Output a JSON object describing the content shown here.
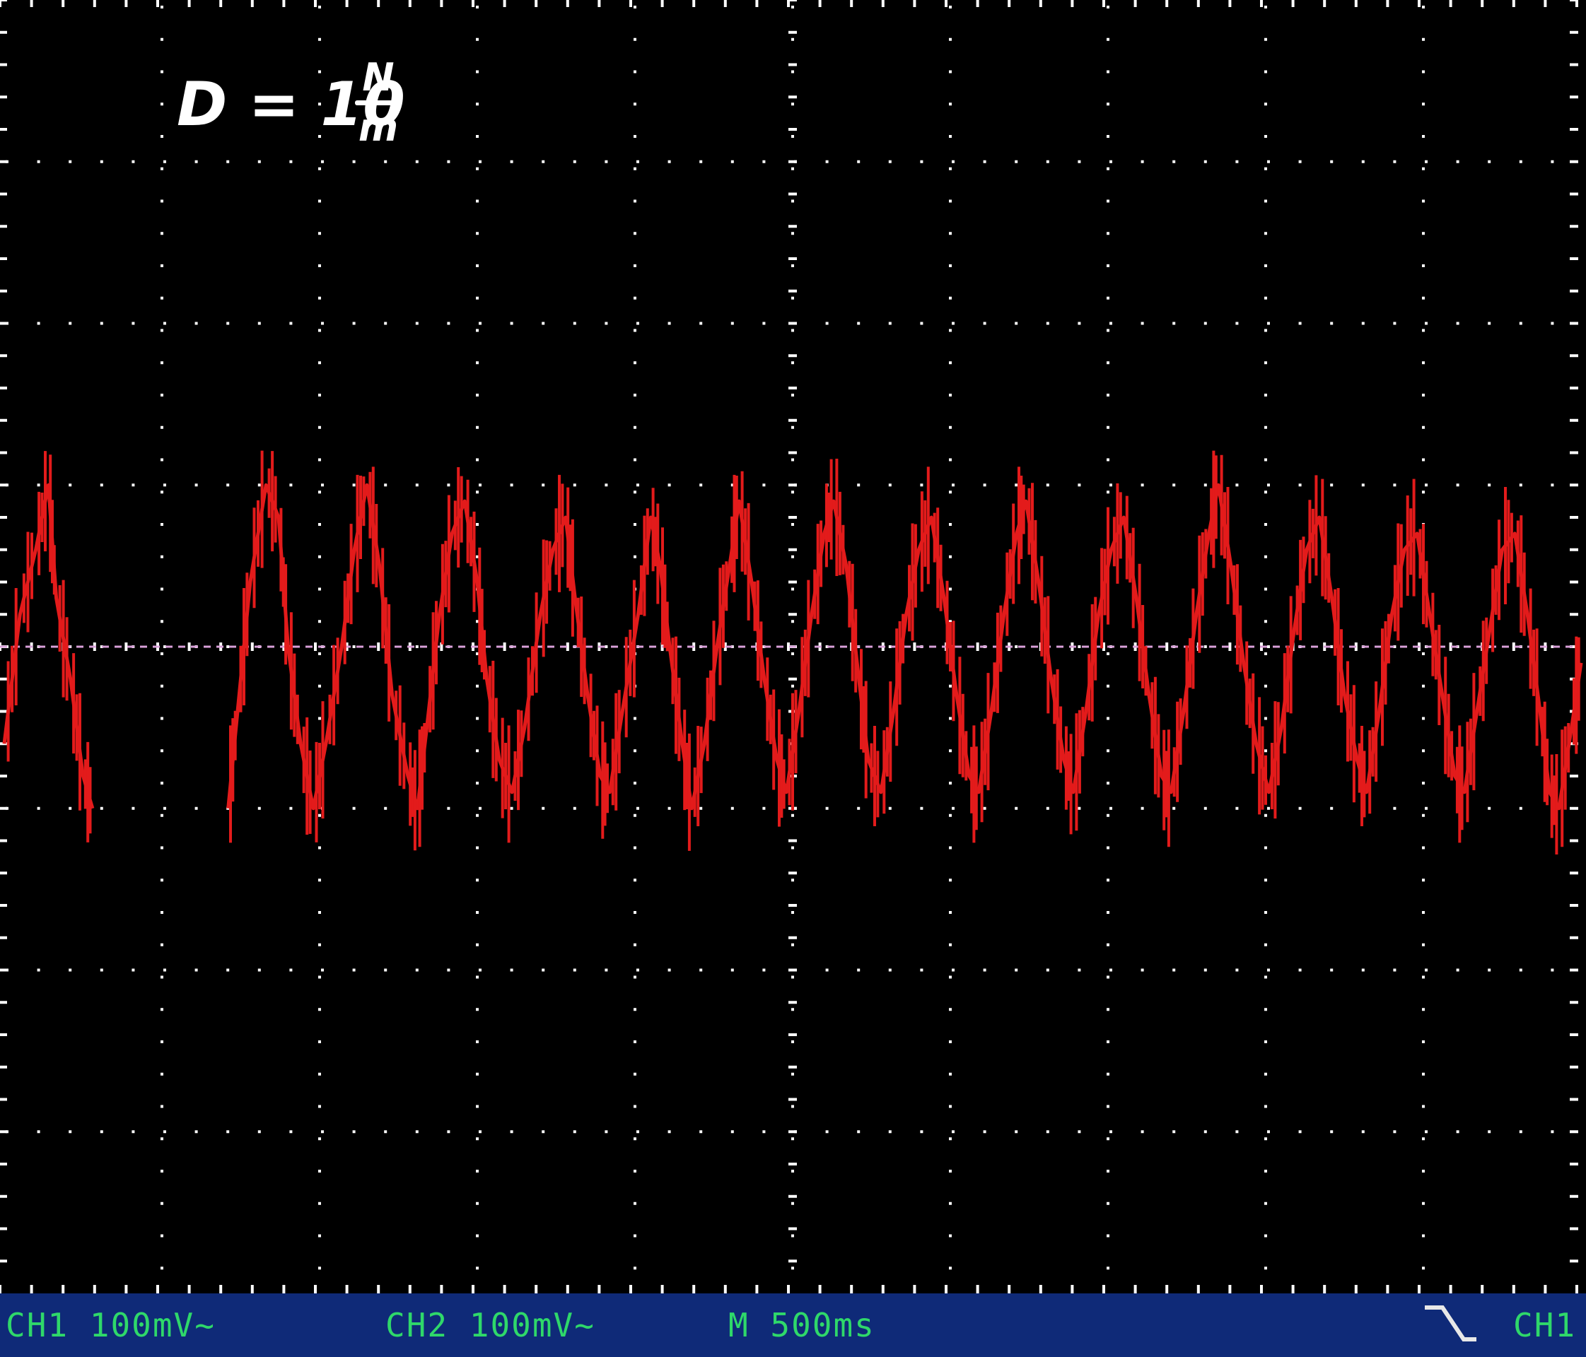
{
  "annotation": {
    "lhs": "D = 10",
    "numerator": "N",
    "denominator": "m"
  },
  "status": {
    "ch1": "CH1 100mV~",
    "ch2": "CH2 100mV~",
    "timebase": "M 500ms",
    "trigger_source": "CH1",
    "trigger_slope_icon": "falling-edge-icon"
  },
  "colors": {
    "screen": "#000000",
    "grid": "#ffffff",
    "trace": "#e31b1b",
    "reference_line": "#d9a0d9",
    "status_bar": "#0f2a78",
    "status_text": "#2fd86a"
  },
  "chart_data": {
    "type": "line",
    "title": "",
    "xlabel": "",
    "ylabel": "",
    "x_divisions": 10,
    "y_divisions": 8,
    "x_unit_per_div": "500ms",
    "y_unit_per_div": "100mV",
    "xlim": [
      0,
      10
    ],
    "ylim": [
      -4,
      4
    ],
    "grid": true,
    "series": [
      {
        "values_note_x_in_div_y_in_div": "",
        "points": [
          [
            0.0,
            -0.6
          ],
          [
            0.1,
            0.2
          ],
          [
            0.2,
            0.6
          ],
          [
            0.28,
            1.0
          ],
          [
            0.33,
            0.3
          ],
          [
            0.42,
            -0.2
          ],
          [
            0.5,
            -0.8
          ],
          [
            0.56,
            -1.0
          ],
          [
            1.42,
            -1.0
          ],
          [
            1.48,
            -0.4
          ],
          [
            1.56,
            0.4
          ],
          [
            1.66,
            1.0
          ],
          [
            1.74,
            0.8
          ],
          [
            1.8,
            0.0
          ],
          [
            1.88,
            -0.6
          ],
          [
            1.96,
            -1.0
          ],
          [
            2.04,
            -0.6
          ],
          [
            2.14,
            0.0
          ],
          [
            2.22,
            0.6
          ],
          [
            2.3,
            1.0
          ],
          [
            2.38,
            0.5
          ],
          [
            2.46,
            -0.3
          ],
          [
            2.56,
            -0.8
          ],
          [
            2.62,
            -1.0
          ],
          [
            2.68,
            -0.5
          ],
          [
            2.76,
            0.2
          ],
          [
            2.84,
            0.7
          ],
          [
            2.92,
            0.9
          ],
          [
            3.0,
            0.4
          ],
          [
            3.06,
            -0.2
          ],
          [
            3.14,
            -0.7
          ],
          [
            3.22,
            -0.9
          ],
          [
            3.3,
            -0.5
          ],
          [
            3.4,
            0.2
          ],
          [
            3.48,
            0.6
          ],
          [
            3.56,
            0.8
          ],
          [
            3.62,
            0.3
          ],
          [
            3.7,
            -0.3
          ],
          [
            3.78,
            -0.8
          ],
          [
            3.84,
            -0.9
          ],
          [
            3.92,
            -0.4
          ],
          [
            4.02,
            0.2
          ],
          [
            4.1,
            0.8
          ],
          [
            4.16,
            0.5
          ],
          [
            4.22,
            0.0
          ],
          [
            4.3,
            -0.6
          ],
          [
            4.36,
            -1.0
          ],
          [
            4.44,
            -0.6
          ],
          [
            4.52,
            0.0
          ],
          [
            4.6,
            0.5
          ],
          [
            4.66,
            0.9
          ],
          [
            4.74,
            0.4
          ],
          [
            4.82,
            -0.2
          ],
          [
            4.9,
            -0.7
          ],
          [
            4.96,
            -0.9
          ],
          [
            5.04,
            -0.4
          ],
          [
            5.12,
            0.2
          ],
          [
            5.2,
            0.7
          ],
          [
            5.26,
            0.9
          ],
          [
            5.34,
            0.5
          ],
          [
            5.42,
            -0.2
          ],
          [
            5.48,
            -0.7
          ],
          [
            5.56,
            -0.9
          ],
          [
            5.64,
            -0.4
          ],
          [
            5.72,
            0.2
          ],
          [
            5.8,
            0.6
          ],
          [
            5.88,
            0.8
          ],
          [
            5.96,
            0.3
          ],
          [
            6.04,
            -0.3
          ],
          [
            6.12,
            -0.8
          ],
          [
            6.18,
            -0.9
          ],
          [
            6.26,
            -0.4
          ],
          [
            6.34,
            0.2
          ],
          [
            6.42,
            0.7
          ],
          [
            6.48,
            0.9
          ],
          [
            6.56,
            0.4
          ],
          [
            6.64,
            -0.2
          ],
          [
            6.72,
            -0.7
          ],
          [
            6.78,
            -0.9
          ],
          [
            6.86,
            -0.4
          ],
          [
            6.94,
            0.2
          ],
          [
            7.02,
            0.6
          ],
          [
            7.1,
            0.8
          ],
          [
            7.18,
            0.3
          ],
          [
            7.26,
            -0.3
          ],
          [
            7.34,
            -0.8
          ],
          [
            7.4,
            -0.9
          ],
          [
            7.48,
            -0.4
          ],
          [
            7.56,
            0.2
          ],
          [
            7.64,
            0.7
          ],
          [
            7.7,
            1.0
          ],
          [
            7.78,
            0.5
          ],
          [
            7.86,
            -0.1
          ],
          [
            7.94,
            -0.6
          ],
          [
            8.02,
            -0.9
          ],
          [
            8.1,
            -0.5
          ],
          [
            8.18,
            0.1
          ],
          [
            8.26,
            0.6
          ],
          [
            8.34,
            0.8
          ],
          [
            8.42,
            0.3
          ],
          [
            8.5,
            -0.3
          ],
          [
            8.58,
            -0.7
          ],
          [
            8.64,
            -0.9
          ],
          [
            8.72,
            -0.4
          ],
          [
            8.8,
            0.2
          ],
          [
            8.88,
            0.6
          ],
          [
            8.96,
            0.7
          ],
          [
            9.04,
            0.2
          ],
          [
            9.12,
            -0.3
          ],
          [
            9.2,
            -0.8
          ],
          [
            9.26,
            -0.9
          ],
          [
            9.34,
            -0.4
          ],
          [
            9.42,
            0.1
          ],
          [
            9.5,
            0.6
          ],
          [
            9.58,
            0.7
          ],
          [
            9.66,
            0.2
          ],
          [
            9.74,
            -0.4
          ],
          [
            9.8,
            -0.9
          ],
          [
            9.86,
            -1.0
          ],
          [
            9.94,
            -0.5
          ],
          [
            10.0,
            -0.1
          ]
        ]
      }
    ]
  }
}
